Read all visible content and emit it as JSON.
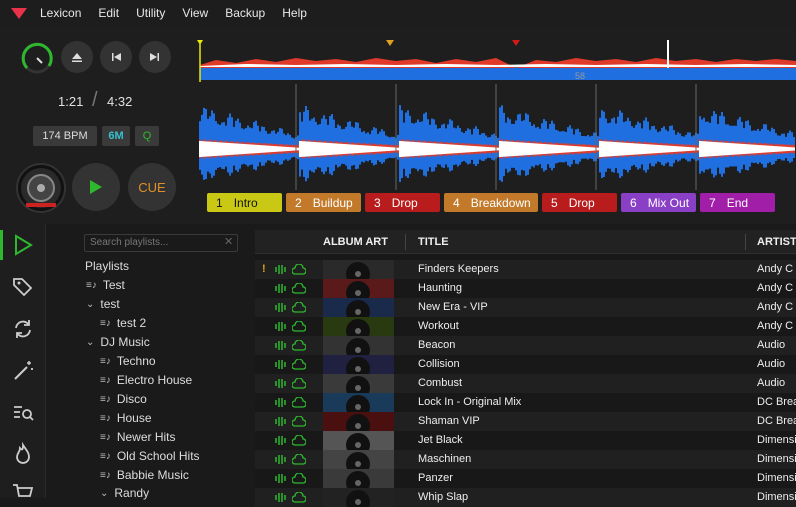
{
  "menu": [
    "Lexicon",
    "Edit",
    "Utility",
    "View",
    "Backup",
    "Help"
  ],
  "player": {
    "time_elapsed": "1:21",
    "time_separator": "/",
    "time_total": "4:32",
    "bpm": "174 BPM",
    "key": "6M",
    "quantize": "Q",
    "cue_label": "CUE",
    "beat_marker": "58"
  },
  "cues": [
    {
      "num": "1",
      "label": "Intro",
      "color": "#c9c915",
      "text": "#111"
    },
    {
      "num": "2",
      "label": "Buildup",
      "color": "#c27a2a",
      "text": "#fff"
    },
    {
      "num": "3",
      "label": "Drop",
      "color": "#b81c1c",
      "text": "#fff"
    },
    {
      "num": "4",
      "label": "Breakdown",
      "color": "#c27a2a",
      "text": "#fff"
    },
    {
      "num": "5",
      "label": "Drop",
      "color": "#b81c1c",
      "text": "#fff"
    },
    {
      "num": "6",
      "label": "Mix Out",
      "color": "#8a3fc7",
      "text": "#fff"
    },
    {
      "num": "7",
      "label": "End",
      "color": "#a11fa8",
      "text": "#fff"
    }
  ],
  "playlists": {
    "search_placeholder": "Search playlists...",
    "heading": "Playlists",
    "items": [
      "Test",
      "test",
      "test 2",
      "DJ Music",
      "Techno",
      "Electro House",
      "Disco",
      "House",
      "Newer Hits",
      "Old School Hits",
      "Babbie Music",
      "Randy"
    ]
  },
  "table": {
    "headers": {
      "art": "ALBUM ART",
      "title": "TITLE",
      "artist": "ARTIST"
    },
    "first_row_flag": "!",
    "rows": [
      {
        "title": "Finders Keepers",
        "artist": "Andy C"
      },
      {
        "title": "Haunting",
        "artist": "Andy C"
      },
      {
        "title": "New Era - VIP",
        "artist": "Andy C"
      },
      {
        "title": "Workout",
        "artist": "Andy C"
      },
      {
        "title": "Beacon",
        "artist": "Audio"
      },
      {
        "title": "Collision",
        "artist": "Audio"
      },
      {
        "title": "Combust",
        "artist": "Audio"
      },
      {
        "title": "Lock In - Original Mix",
        "artist": "DC Brea"
      },
      {
        "title": "Shaman VIP",
        "artist": "DC Brea"
      },
      {
        "title": "Jet Black",
        "artist": "Dimensi"
      },
      {
        "title": "Maschinen",
        "artist": "Dimensi"
      },
      {
        "title": "Panzer",
        "artist": "Dimensi"
      },
      {
        "title": "Whip Slap",
        "artist": "Dimensi"
      }
    ]
  },
  "colors": {
    "accent_green": "#2eb82e",
    "wave_blue": "#1f6fe0",
    "wave_red": "#e03a2a",
    "cue_orange": "#e0a020"
  }
}
